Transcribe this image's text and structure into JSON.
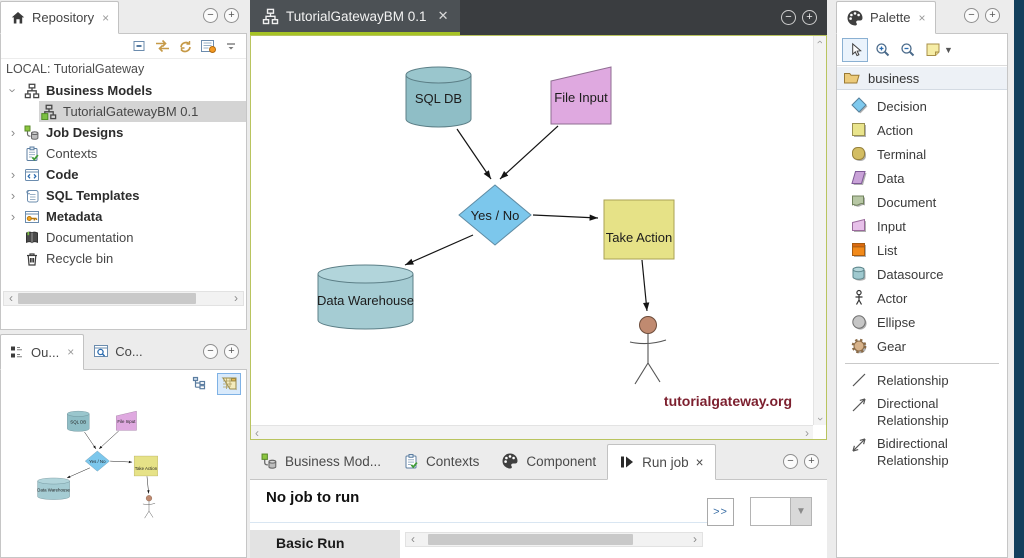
{
  "repository": {
    "tab_label": "Repository",
    "local_label": "LOCAL: TutorialGateway",
    "items": {
      "business_models": "Business Models",
      "tutorial_bm": "TutorialGatewayBM 0.1",
      "job_designs": "Job Designs",
      "contexts": "Contexts",
      "code": "Code",
      "sql_templates": "SQL Templates",
      "metadata": "Metadata",
      "documentation": "Documentation",
      "recycle_bin": "Recycle bin"
    }
  },
  "outline": {
    "outline_tab": "Ou...",
    "code_tab": "Co..."
  },
  "editor": {
    "tab_label": "TutorialGatewayBM 0.1",
    "watermark": "tutorialgateway.org",
    "nodes": {
      "sql_db": "SQL DB",
      "file_input": "File Input",
      "decision": "Yes / No",
      "take_action": "Take Action",
      "data_warehouse": "Data Warehouse"
    }
  },
  "bottom_panel": {
    "tabs": {
      "business_models": "Business Mod...",
      "contexts": "Contexts",
      "component": "Component",
      "run_job": "Run job"
    },
    "no_job_message": "No job to run",
    "basic_run_label": "Basic Run",
    "more_button": ">>"
  },
  "palette": {
    "tab_label": "Palette",
    "group_label": "business",
    "items": [
      "Decision",
      "Action",
      "Terminal",
      "Data",
      "Document",
      "Input",
      "List",
      "Datasource",
      "Actor",
      "Ellipse",
      "Gear"
    ],
    "relationship_items": [
      "Relationship",
      "Directional Relationship",
      "Bidirectional Relationship"
    ]
  },
  "colors": {
    "accent_green": "#a6c325",
    "selection_grey": "#d4d4d4",
    "window_edge_blue": "#123f5c"
  }
}
